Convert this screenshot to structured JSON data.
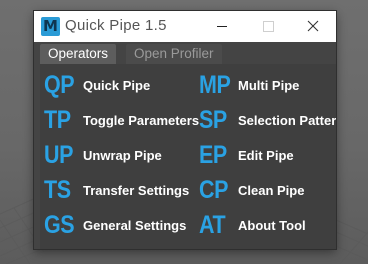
{
  "window": {
    "icon_letter": "M",
    "title": "Quick Pipe 1.5"
  },
  "controls": {
    "minimize": "minimize-icon",
    "maximize": "maximize-icon",
    "close": "close-icon"
  },
  "tabs": [
    {
      "label": "Operators",
      "active": true
    },
    {
      "label": "Open Profiler",
      "active": false
    }
  ],
  "operators": [
    {
      "abbr": "QP",
      "label": "Quick Pipe"
    },
    {
      "abbr": "MP",
      "label": "Multi Pipe"
    },
    {
      "abbr": "TP",
      "label": "Toggle Parameters"
    },
    {
      "abbr": "SP",
      "label": "Selection Patterı"
    },
    {
      "abbr": "UP",
      "label": "Unwrap Pipe"
    },
    {
      "abbr": "EP",
      "label": "Edit Pipe"
    },
    {
      "abbr": "TS",
      "label": "Transfer Settings"
    },
    {
      "abbr": "CP",
      "label": "Clean Pipe"
    },
    {
      "abbr": "GS",
      "label": "General Settings"
    },
    {
      "abbr": "AT",
      "label": "About Tool"
    }
  ],
  "colors": {
    "accent": "#2aa2e4",
    "panel": "#3f3f3f",
    "titlebar": "#ffffff"
  }
}
